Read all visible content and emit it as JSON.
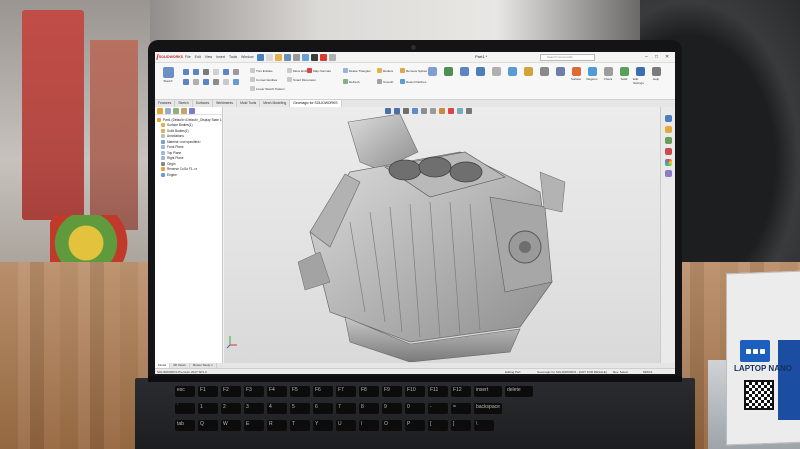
{
  "app": {
    "logo_text": "SOLIDWORKS",
    "menu": [
      "File",
      "Edit",
      "View",
      "Insert",
      "Tools",
      "Window"
    ],
    "document_title": "Part1 *",
    "search_placeholder": "Search Commands",
    "window_controls": [
      "–",
      "□",
      "✕"
    ]
  },
  "ribbon": {
    "left_commands": [
      {
        "label": "Sketch",
        "icon": "sketch-icon"
      }
    ],
    "surface_commands": [
      {
        "label": "Delete Triangles",
        "icon": "delete-triangles-icon"
      },
      {
        "label": "Remove Spikes",
        "icon": "remove-spikes-icon"
      },
      {
        "label": "Reduce",
        "icon": "reduce-icon"
      },
      {
        "label": "Refresh",
        "icon": "refresh-icon"
      },
      {
        "label": "Smooth",
        "icon": "smooth-icon"
      },
      {
        "label": "Detect Patches",
        "icon": "detect-patches-icon"
      }
    ],
    "right_commands": [
      {
        "label": "Surface",
        "icon": "surface-icon"
      },
      {
        "label": "Regions",
        "icon": "regions-icon"
      },
      {
        "label": "Check",
        "icon": "check-icon"
      },
      {
        "label": "Solid",
        "icon": "solid-icon"
      },
      {
        "label": "Edit Settings",
        "icon": "settings-icon"
      },
      {
        "label": "Help",
        "icon": "help-icon"
      }
    ],
    "mid_labels": [
      "Trim Entities",
      "Convert Entities",
      "Linear Sketch Pattern",
      "Move Entities",
      "Map Normals",
      "Display/Delete Relations",
      "Repair Sketch",
      "Rapid Sketch",
      "Smart Dimension"
    ]
  },
  "tabs": [
    "Features",
    "Sketch",
    "Surfaces",
    "Weldments",
    "Mold Tools",
    "Mesh Modeling",
    "Geomagic for SOLIDWORKS"
  ],
  "active_tab": "Geomagic for SOLIDWORKS",
  "feature_tree": [
    {
      "label": "Part1 (Default<<Default>_Display State 1>)",
      "icon": "part-icon",
      "color": "#e6a23c"
    },
    {
      "label": "Surface Bodies(1)",
      "icon": "folder-icon",
      "color": "#d9b35a"
    },
    {
      "label": "Solid Bodies(1)",
      "icon": "folder-icon",
      "color": "#d9b35a"
    },
    {
      "label": "Annotations",
      "icon": "annotation-icon",
      "color": "#c0c0c0"
    },
    {
      "label": "Material <not specified>",
      "icon": "material-icon",
      "color": "#7aa0c4"
    },
    {
      "label": "Front Plane",
      "icon": "plane-icon",
      "color": "#9fb8d8"
    },
    {
      "label": "Top Plane",
      "icon": "plane-icon",
      "color": "#9fb8d8"
    },
    {
      "label": "Right Plane",
      "icon": "plane-icon",
      "color": "#9fb8d8"
    },
    {
      "label": "Origin",
      "icon": "origin-icon",
      "color": "#888888"
    },
    {
      "label": "Reverse CoGo F1->x",
      "icon": "feature-icon",
      "color": "#e6a23c"
    },
    {
      "label": "Engine",
      "icon": "mesh-icon",
      "color": "#6b9cd6"
    }
  ],
  "bottom_tabs": [
    "Model",
    "3D Views",
    "Motion Study 1"
  ],
  "status": {
    "left": "SOLIDWORKS Premium 2017 SP1.0",
    "mid": "Editing Part",
    "mid2": "Geomagic for SOLIDWORKS - [NOT FOR RESALE]",
    "right": "MMGS",
    "custom": "Rev. Select"
  },
  "keyboard": {
    "row1": [
      "esc",
      "F1",
      "F2",
      "F3",
      "F4",
      "F5",
      "F6",
      "F7",
      "F8",
      "F9",
      "F10",
      "F11",
      "F12",
      "insert",
      "delete"
    ],
    "row2": [
      "`",
      "1",
      "2",
      "3",
      "4",
      "5",
      "6",
      "7",
      "8",
      "9",
      "0",
      "-",
      "=",
      "backspace"
    ],
    "row3": [
      "tab",
      "Q",
      "W",
      "E",
      "R",
      "T",
      "Y",
      "U",
      "I",
      "O",
      "P",
      "[",
      "]",
      "\\"
    ]
  },
  "brand_card": {
    "text": "LAPTOP NANO"
  },
  "colors": {
    "accent": "#c3262b",
    "ribbon_bg": "#f7f7f7",
    "viewport": "#e4e4e4",
    "mesh": "#bcbcbc"
  }
}
